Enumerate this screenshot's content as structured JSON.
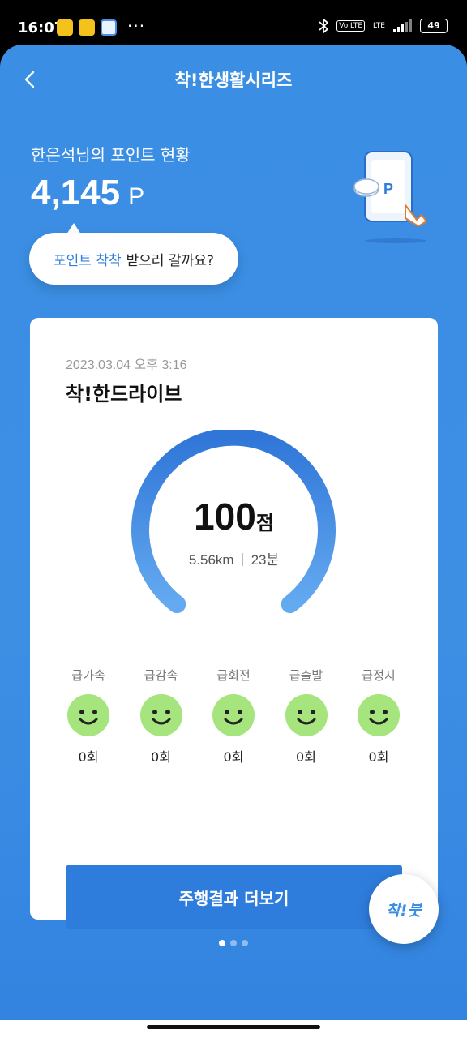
{
  "status_bar": {
    "time": "16:07",
    "dots": "···",
    "volte": "Vo LTE",
    "lte": "LTE",
    "battery": "49"
  },
  "header": {
    "title": "착!한생활시리즈",
    "back_icon": "chevron-left-icon"
  },
  "points": {
    "label": "한은석님의 포인트 현황",
    "value": "4,145",
    "unit": "P",
    "bubble_highlight": "포인트 착착",
    "bubble_text": "받으러 갈까요?",
    "illustration_letter": "P"
  },
  "card": {
    "date": "2023.03.04 오후 3:16",
    "title": "착!한드라이브",
    "score": "100",
    "score_unit": "점",
    "distance": "5.56km",
    "duration": "23분",
    "gauge_level": 100,
    "metrics": [
      {
        "label": "급가속",
        "count": "0회",
        "icon": "smile-icon"
      },
      {
        "label": "급감속",
        "count": "0회",
        "icon": "smile-icon"
      },
      {
        "label": "급회전",
        "count": "0회",
        "icon": "smile-icon"
      },
      {
        "label": "급출발",
        "count": "0회",
        "icon": "smile-icon"
      },
      {
        "label": "급정지",
        "count": "0회",
        "icon": "smile-icon"
      }
    ],
    "more_button": "주행결과 더보기"
  },
  "fab": {
    "label": "착!붓"
  },
  "pager": {
    "count": 3,
    "active": 1
  },
  "colors": {
    "background": "#3a8ee3",
    "accent": "#2e7ddc",
    "face": "#a6e57d"
  }
}
